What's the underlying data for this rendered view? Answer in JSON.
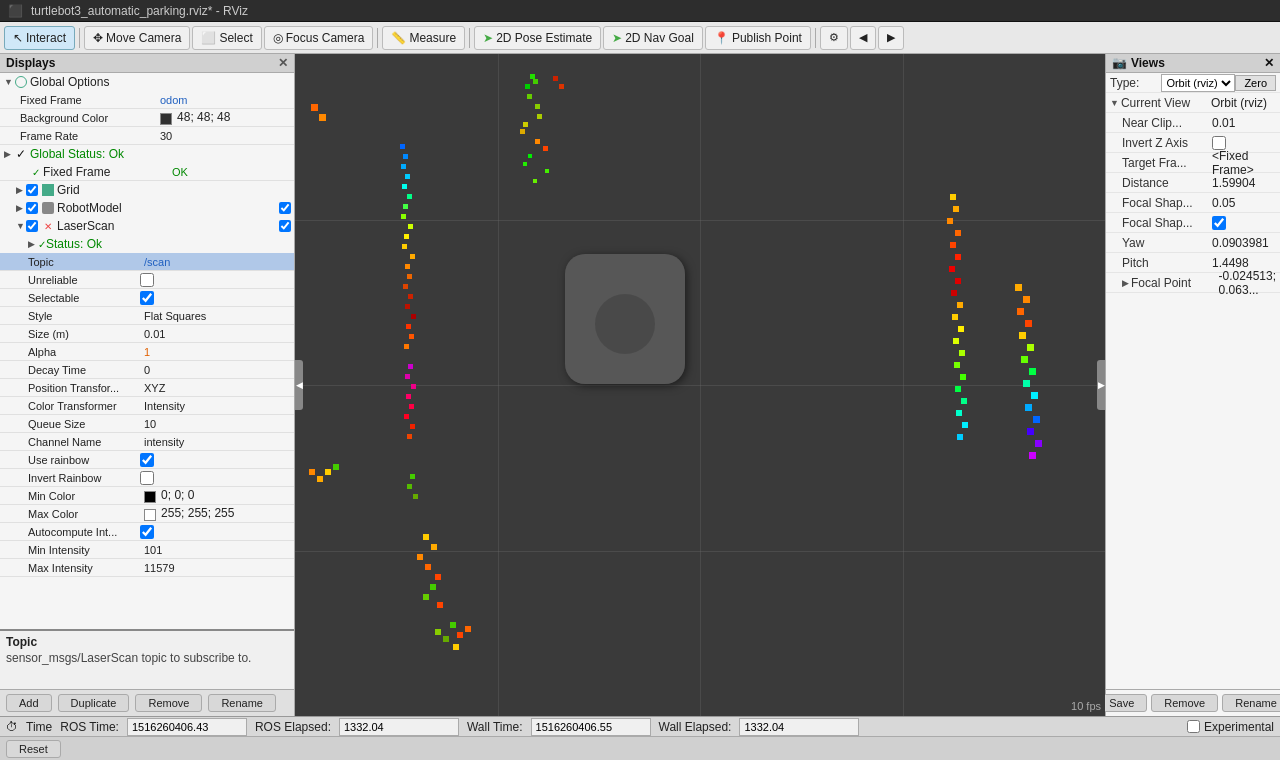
{
  "titlebar": {
    "title": "turtlebot3_automatic_parking.rviz* - RViz"
  },
  "toolbar": {
    "interact": "Interact",
    "move_camera": "Move Camera",
    "select": "Select",
    "focus_camera": "Focus Camera",
    "measure": "Measure",
    "pose_estimate": "2D Pose Estimate",
    "nav_goal": "2D Nav Goal",
    "publish_point": "Publish Point"
  },
  "displays": {
    "title": "Displays",
    "global_options": {
      "label": "Global Options",
      "fixed_frame_label": "Fixed Frame",
      "fixed_frame_value": "odom",
      "background_color_label": "Background Color",
      "background_color_value": "48; 48; 48",
      "frame_rate_label": "Frame Rate",
      "frame_rate_value": "30"
    },
    "global_status": {
      "label": "Global Status: Ok",
      "fixed_frame_label": "Fixed Frame",
      "fixed_frame_value": "OK"
    },
    "grid": {
      "label": "Grid"
    },
    "robot_model": {
      "label": "RobotModel"
    },
    "laser_scan": {
      "label": "LaserScan",
      "status": "Status: Ok",
      "topic_label": "Topic",
      "topic_value": "/scan",
      "unreliable_label": "Unreliable",
      "selectable_label": "Selectable",
      "style_label": "Style",
      "style_value": "Flat Squares",
      "size_label": "Size (m)",
      "size_value": "0.01",
      "alpha_label": "Alpha",
      "alpha_value": "1",
      "decay_label": "Decay Time",
      "decay_value": "0",
      "position_transform_label": "Position Transfor...",
      "position_transform_value": "XYZ",
      "color_transformer_label": "Color Transformer",
      "color_transformer_value": "Intensity",
      "queue_size_label": "Queue Size",
      "queue_size_value": "10",
      "channel_name_label": "Channel Name",
      "channel_name_value": "intensity",
      "use_rainbow_label": "Use rainbow",
      "invert_rainbow_label": "Invert Rainbow",
      "min_color_label": "Min Color",
      "min_color_value": "0; 0; 0",
      "max_color_label": "Max Color",
      "max_color_value": "255; 255; 255",
      "autocompute_label": "Autocompute Int...",
      "min_intensity_label": "Min Intensity",
      "min_intensity_value": "101",
      "max_intensity_label": "Max Intensity",
      "max_intensity_value": "11579"
    }
  },
  "tooltip": {
    "title": "Topic",
    "desc": "sensor_msgs/LaserScan topic to subscribe to."
  },
  "bottom_buttons": {
    "add": "Add",
    "duplicate": "Duplicate",
    "remove": "Remove",
    "rename": "Rename"
  },
  "views": {
    "title": "Views",
    "type_label": "Type:",
    "type_value": "Orbit (rviz)",
    "zero_label": "Zero",
    "current_view_label": "Current View",
    "current_view_value": "Orbit (rviz)",
    "near_clip_label": "Near Clip...",
    "near_clip_value": "0.01",
    "invert_z_label": "Invert Z Axis",
    "target_frame_label": "Target Fra...",
    "target_frame_value": "<Fixed Frame>",
    "distance_label": "Distance",
    "distance_value": "1.59904",
    "focal_shape1_label": "Focal Shap...",
    "focal_shape1_value": "0.05",
    "focal_shape2_label": "Focal Shap...",
    "focal_shape2_value": "",
    "yaw_label": "Yaw",
    "yaw_value": "0.0903981",
    "pitch_label": "Pitch",
    "pitch_value": "1.4498",
    "focal_point_label": "Focal Point",
    "focal_point_value": "-0.024513; 0.063..."
  },
  "right_buttons": {
    "save": "Save",
    "remove": "Remove",
    "rename": "Rename"
  },
  "timebar": {
    "time_label": "Time",
    "ros_time_label": "ROS Time:",
    "ros_time_value": "1516260406.43",
    "ros_elapsed_label": "ROS Elapsed:",
    "ros_elapsed_value": "1332.04",
    "wall_time_label": "Wall Time:",
    "wall_time_value": "1516260406.55",
    "wall_elapsed_label": "Wall Elapsed:",
    "wall_elapsed_value": "1332.04",
    "experimental": "Experimental",
    "fps": "10 fps",
    "reset": "Reset"
  }
}
